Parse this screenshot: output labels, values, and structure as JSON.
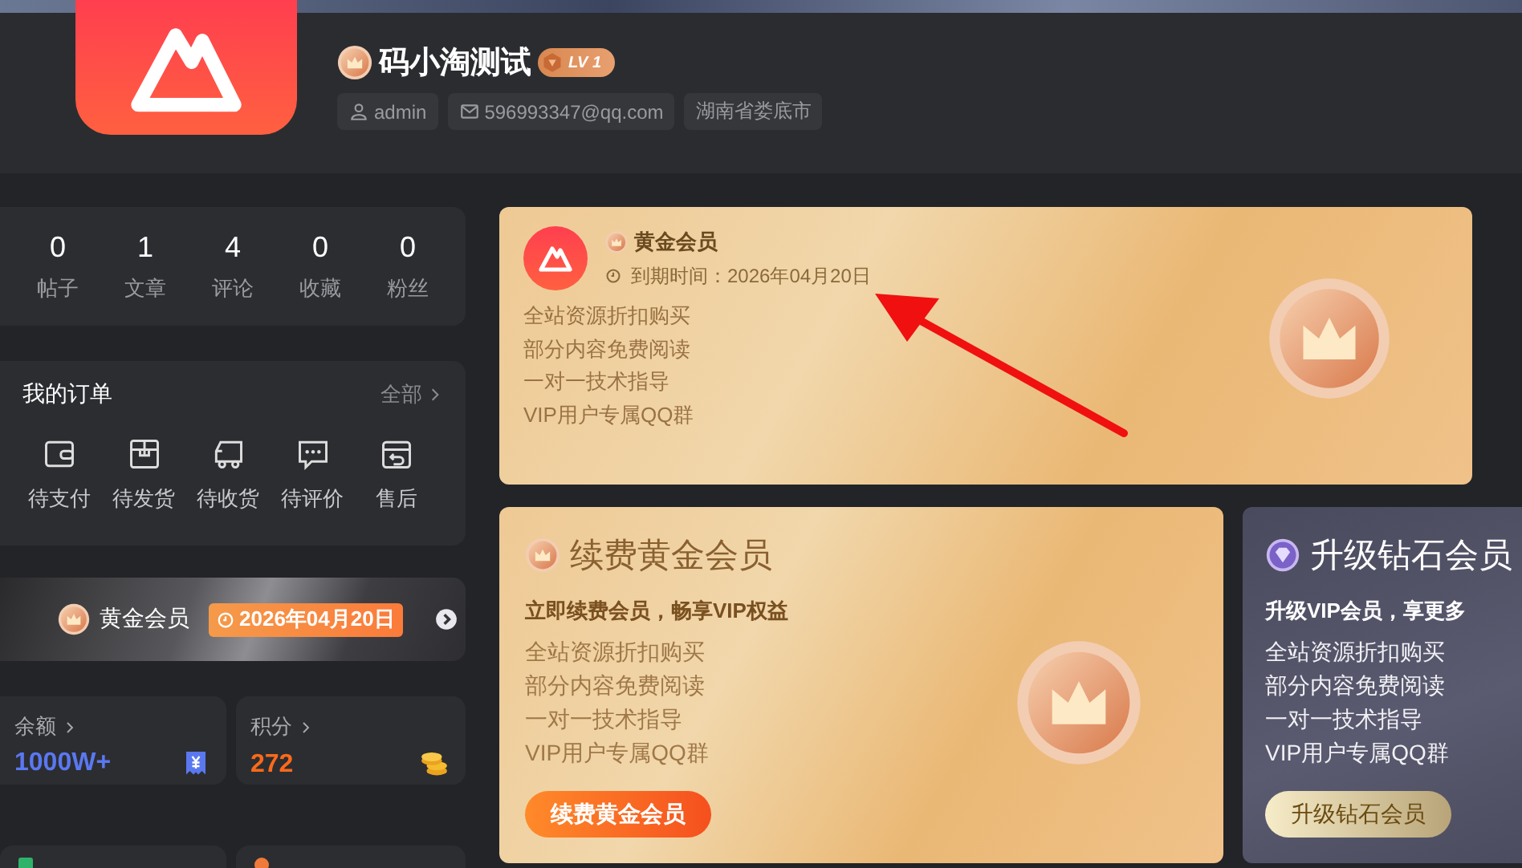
{
  "header": {
    "name": "码小淘测试",
    "level_badge": "LV 1",
    "tags": [
      {
        "kind": "user",
        "text": "admin"
      },
      {
        "kind": "email",
        "text": "596993347@qq.com"
      },
      {
        "kind": "plain",
        "text": "湖南省娄底市"
      }
    ]
  },
  "stats": [
    {
      "value": "0",
      "label": "帖子"
    },
    {
      "value": "1",
      "label": "文章"
    },
    {
      "value": "4",
      "label": "评论"
    },
    {
      "value": "0",
      "label": "收藏"
    },
    {
      "value": "0",
      "label": "粉丝"
    }
  ],
  "orders": {
    "title": "我的订单",
    "more": "全部",
    "items": [
      {
        "kind": "wallet",
        "label": "待支付"
      },
      {
        "kind": "package",
        "label": "待发货"
      },
      {
        "kind": "truck",
        "label": "待收货"
      },
      {
        "kind": "chat",
        "label": "待评价"
      },
      {
        "kind": "return",
        "label": "售后"
      }
    ]
  },
  "member_banner": {
    "name": "黄金会员",
    "expiry": "2026年04月20日"
  },
  "wallet": [
    {
      "kind": "balance",
      "label": "余额",
      "value": "1000W+"
    },
    {
      "kind": "points",
      "label": "积分",
      "value": "272"
    }
  ],
  "current_vip": {
    "name": "黄金会员",
    "expiry": "到期时间：2026年04月20日",
    "benefits": [
      "全站资源折扣购买",
      "部分内容免费阅读",
      "一对一技术指导",
      "VIP用户专属QQ群"
    ]
  },
  "plans": [
    {
      "kind": "gold",
      "title": "续费黄金会员",
      "subtitle": "立即续费会员，畅享VIP权益",
      "benefits": [
        "全站资源折扣购买",
        "部分内容免费阅读",
        "一对一技术指导",
        "VIP用户专属QQ群"
      ],
      "button": "续费黄金会员"
    },
    {
      "kind": "diamond",
      "title": "升级钻石会员",
      "subtitle": "升级VIP会员，享更多",
      "benefits": [
        "全站资源折扣购买",
        "部分内容免费阅读",
        "一对一技术指导",
        "VIP用户专属QQ群"
      ],
      "button": "升级钻石会员"
    }
  ],
  "bottom_cards": [
    {
      "kind": "create"
    },
    {
      "kind": "promote"
    }
  ]
}
